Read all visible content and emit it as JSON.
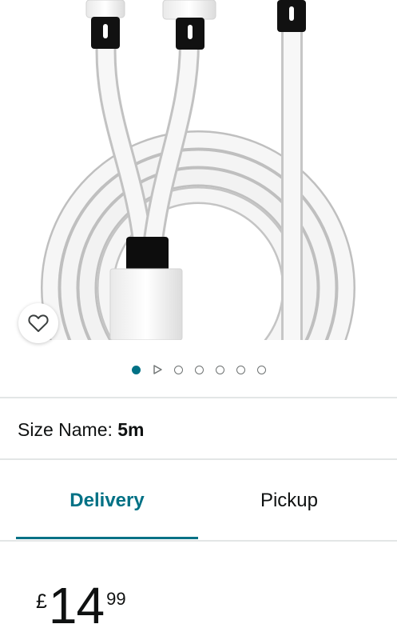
{
  "product_image": {
    "alt": "white 3-way splitter cable coiled, 5m",
    "icon": "cable-image"
  },
  "wishlist": {
    "icon": "heart-outline-icon"
  },
  "carousel": {
    "active_index": 0,
    "total": 7,
    "video_indicator_index": 1
  },
  "size": {
    "label": "Size Name: ",
    "value": "5m"
  },
  "tabs": [
    {
      "label": "Delivery",
      "selected": true
    },
    {
      "label": "Pickup",
      "selected": false
    }
  ],
  "price": {
    "currency": "£",
    "whole": "14",
    "fraction": "99"
  },
  "colors": {
    "accent": "#007185",
    "text": "#0f1111",
    "divider": "#e3e6e6"
  }
}
